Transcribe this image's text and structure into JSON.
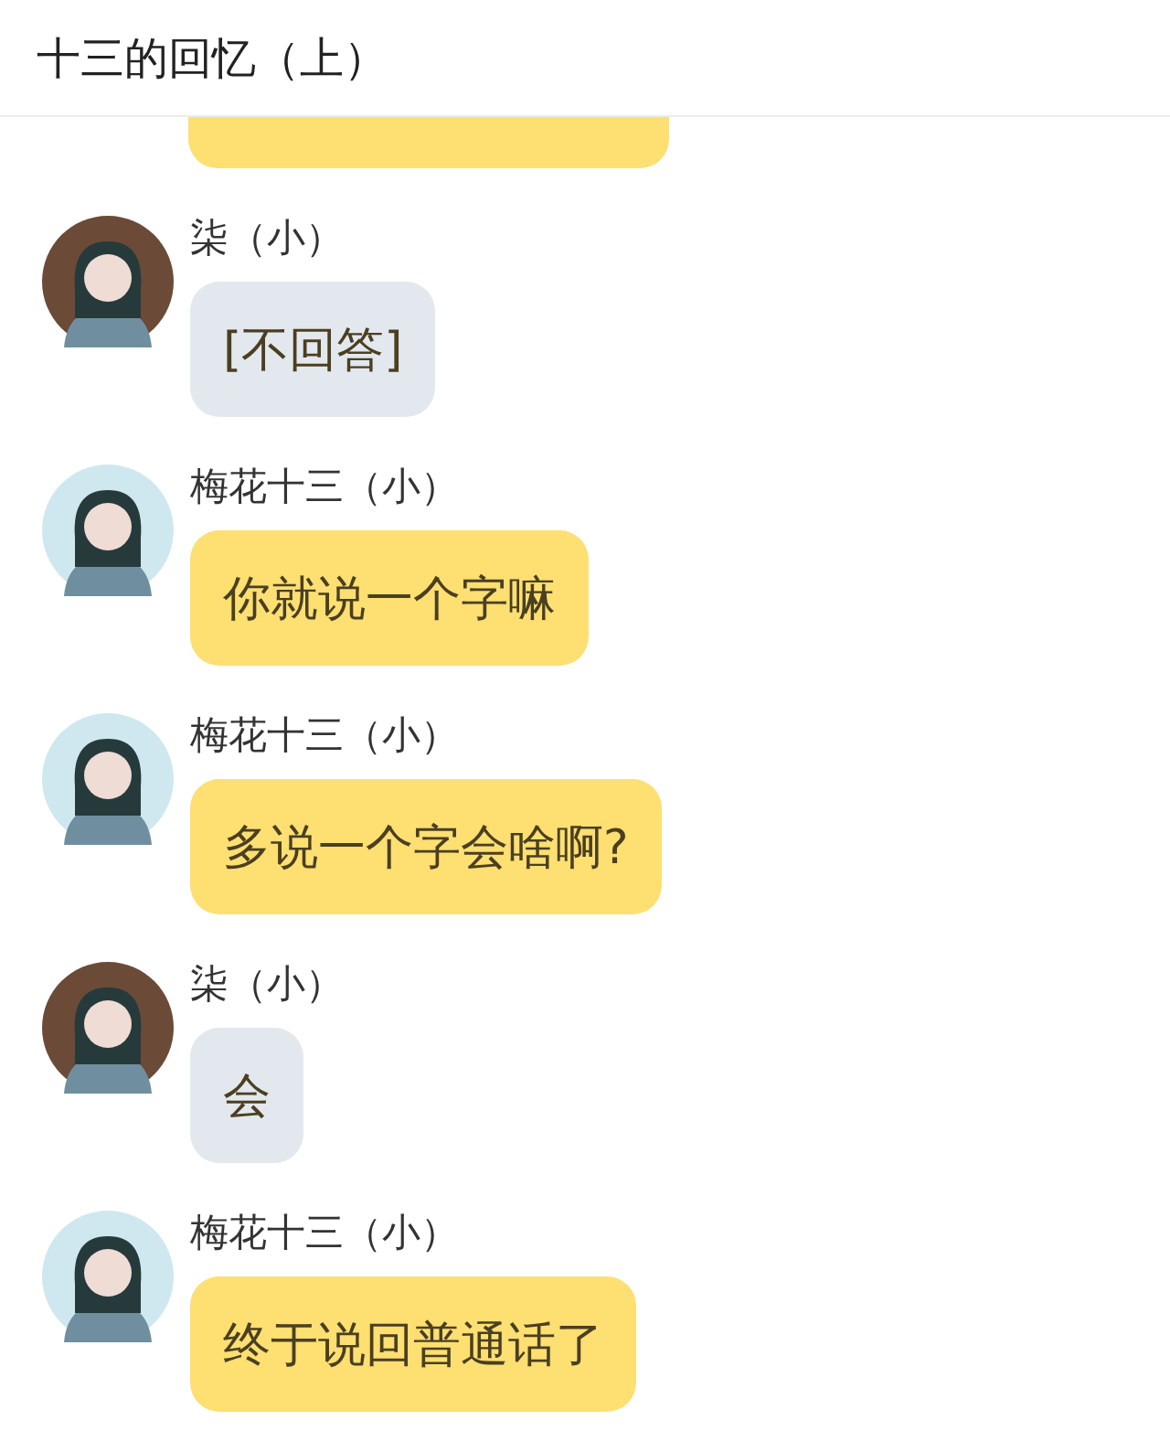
{
  "header": {
    "title": "十三的回忆（上）"
  },
  "messages": [
    {
      "kind": "clipped",
      "color": "#fddf72"
    },
    {
      "kind": "message",
      "sender": "柒（小）",
      "avatar": {
        "color": "#6b4a38"
      },
      "text": "[不回答]",
      "color": "#e3e8ef"
    },
    {
      "kind": "message",
      "sender": "梅花十三（小）",
      "avatar": {
        "color": "#cfe8f0"
      },
      "text": "你就说一个字嘛",
      "color": "#fddf72"
    },
    {
      "kind": "message",
      "sender": "梅花十三（小）",
      "avatar": {
        "color": "#cfe8f0"
      },
      "text": "多说一个字会啥啊?",
      "color": "#fddf72"
    },
    {
      "kind": "message",
      "sender": "柒（小）",
      "avatar": {
        "color": "#6b4a38"
      },
      "text": "会",
      "color": "#e3e8ef"
    },
    {
      "kind": "message",
      "sender": "梅花十三（小）",
      "avatar": {
        "color": "#cfe8f0"
      },
      "text": "终于说回普通话了",
      "color": "#fddf72"
    }
  ]
}
